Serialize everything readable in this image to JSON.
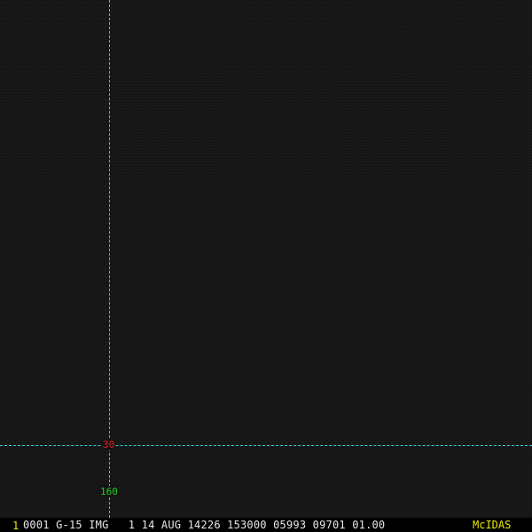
{
  "display": {
    "grid_color": "#2fd0d0",
    "background_color": "#141414"
  },
  "grid": {
    "latitude_label": "30",
    "latitude_label_color": "#e02020",
    "longitude_label": "160",
    "longitude_label_color": "#20d020"
  },
  "status_bar": {
    "frame_number": "1",
    "header": "0001 G-15 IMG   1 14 AUG 14226 153000 05993 09701 01.00",
    "brand": "McIDAS"
  }
}
